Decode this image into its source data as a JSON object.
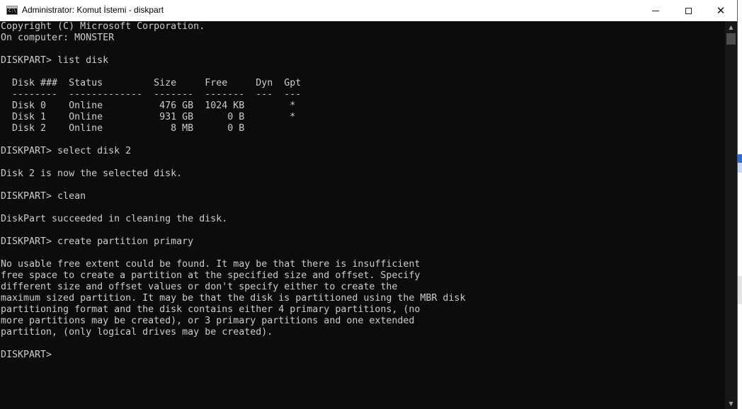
{
  "window": {
    "title": "Administrator: Komut İstemi - diskpart",
    "icon_label": "C:\\",
    "controls": {
      "minimize": "minimize-icon",
      "maximize": "maximize-icon",
      "close": "close-icon"
    }
  },
  "console": {
    "lines": [
      "Copyright (C) Microsoft Corporation.",
      "On computer: MONSTER",
      "",
      "DISKPART> list disk",
      "",
      "  Disk ###  Status         Size     Free     Dyn  Gpt",
      "  --------  -------------  -------  -------  ---  ---",
      "  Disk 0    Online          476 GB  1024 KB        *",
      "  Disk 1    Online          931 GB      0 B        *",
      "  Disk 2    Online            8 MB      0 B",
      "",
      "DISKPART> select disk 2",
      "",
      "Disk 2 is now the selected disk.",
      "",
      "DISKPART> clean",
      "",
      "DiskPart succeeded in cleaning the disk.",
      "",
      "DISKPART> create partition primary",
      "",
      "No usable free extent could be found. It may be that there is insufficient",
      "free space to create a partition at the specified size and offset. Specify",
      "different size and offset values or don't specify either to create the",
      "maximum sized partition. It may be that the disk is partitioned using the MBR disk",
      "partitioning format and the disk contains either 4 primary partitions, (no",
      "more partitions may be created), or 3 primary partitions and one extended",
      "partition, (only logical drives may be created).",
      "",
      "DISKPART>"
    ]
  },
  "scrollbar": {
    "up": "▲",
    "down": "▼"
  },
  "colors": {
    "console_bg": "#0c0c0c",
    "console_text": "#cccccc",
    "titlebar_bg": "#ffffff"
  }
}
